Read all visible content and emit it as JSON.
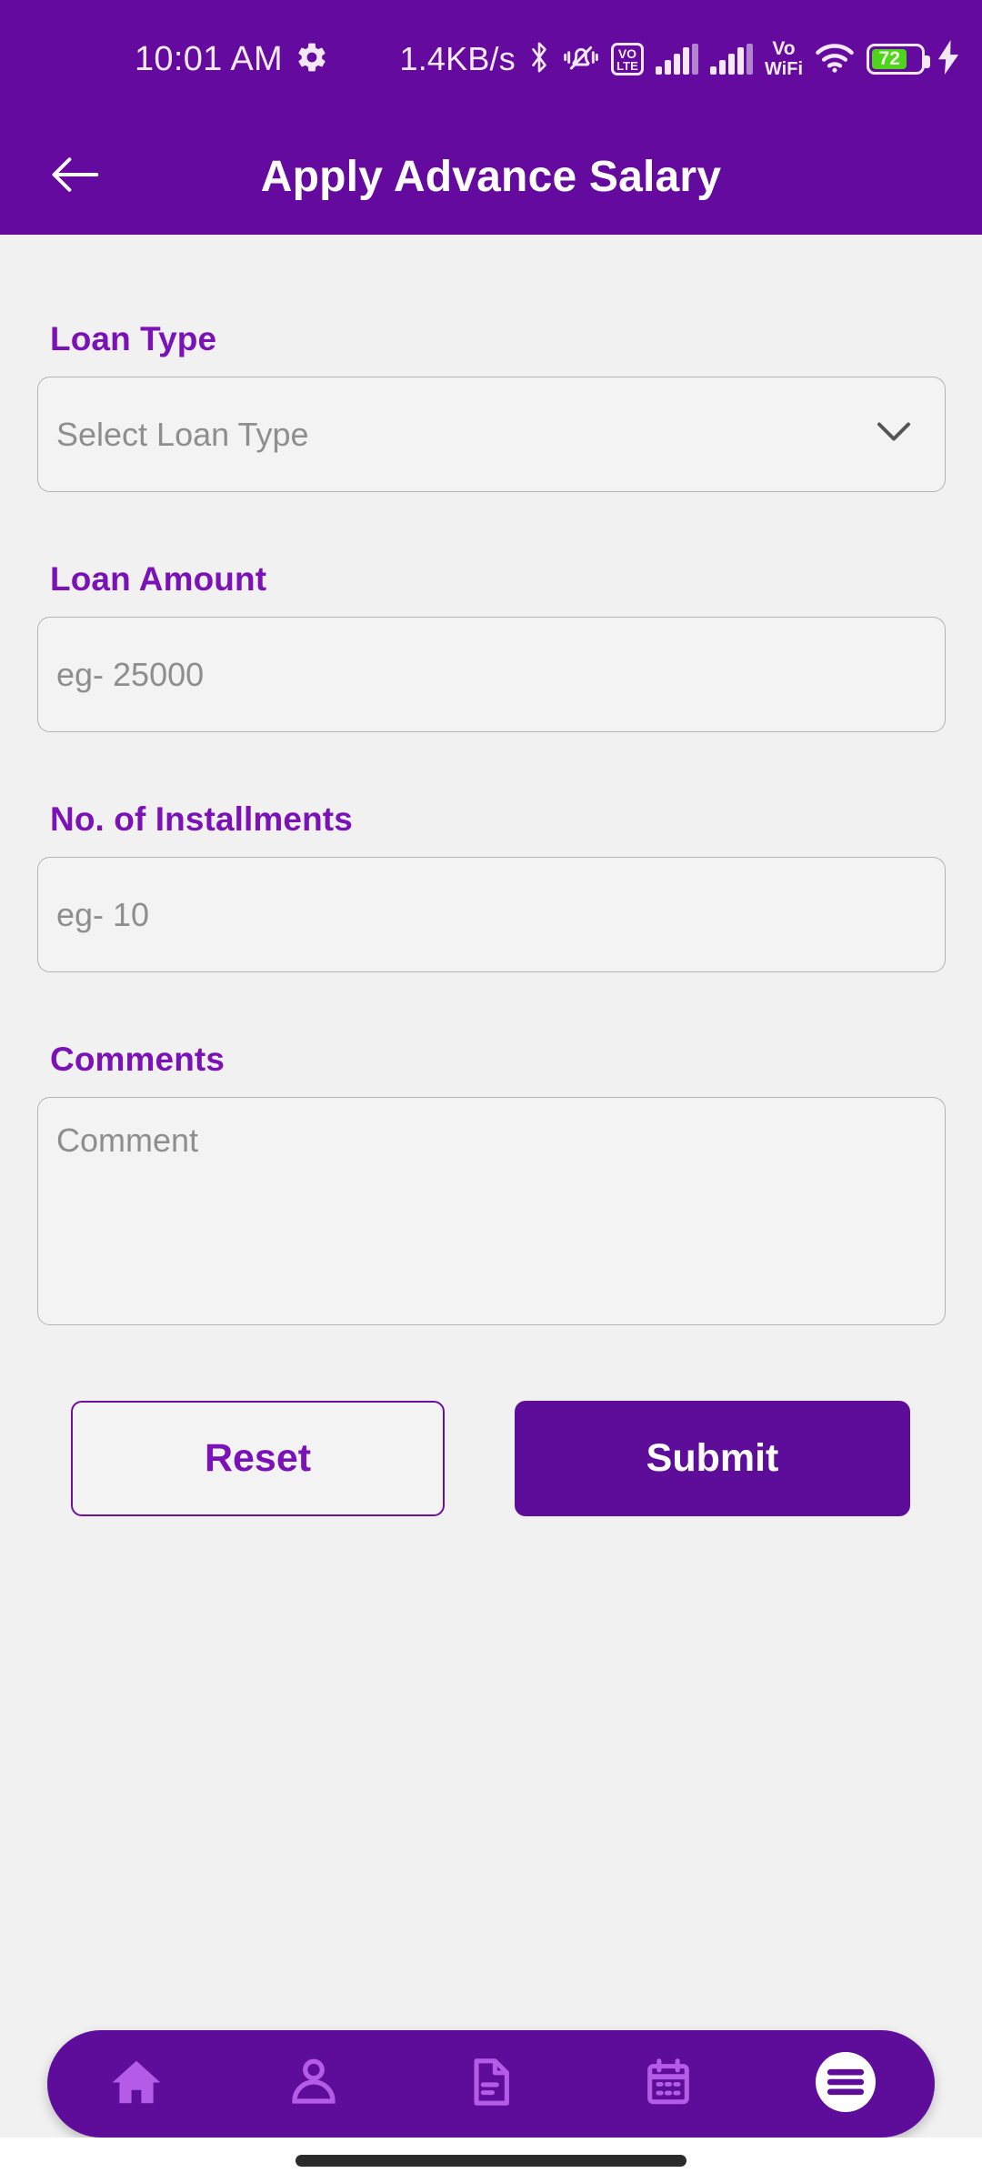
{
  "status_bar": {
    "time": "10:01 AM",
    "settings_icon": "gear-icon",
    "network_speed": "1.4KB/s",
    "bluetooth_icon": "bluetooth-icon",
    "silent_icon": "bell-muted-icon",
    "volte": {
      "line1": "VO",
      "line2": "LTE"
    },
    "signal_1_icon": "signal-bars-icon",
    "signal_2_icon": "signal-bars-icon",
    "vowifi": {
      "line1": "Vo",
      "line2": "WiFi"
    },
    "wifi_icon": "wifi-icon",
    "battery_level": "72",
    "charging_icon": "charging-bolt-icon",
    "background_color": "#650a9e",
    "foreground_color": "#f3e7f8",
    "battery_fill_color": "#4fd41c"
  },
  "app_bar": {
    "back_icon": "arrow-left-icon",
    "title": "Apply Advance Salary",
    "background_color": "#650a9e",
    "text_color": "#ffffff"
  },
  "form": {
    "background_color": "#f1f1f1",
    "label_color": "#7b12b8",
    "placeholder_color": "#8e8e8e",
    "fields": [
      {
        "label": "Loan Type",
        "type": "dropdown",
        "value": "",
        "placeholder": "Select Loan Type",
        "dropdown_icon": "chevron-down-icon"
      },
      {
        "label": "Loan Amount",
        "type": "text",
        "value": "",
        "placeholder": "eg- 25000"
      },
      {
        "label": "No. of Installments",
        "type": "text",
        "value": "",
        "placeholder": "eg- 10"
      },
      {
        "label": "Comments",
        "type": "textarea",
        "value": "",
        "placeholder": "Comment"
      }
    ]
  },
  "actions": {
    "reset_label": "Reset",
    "submit_label": "Submit",
    "reset_color": "#7b12b8",
    "submit_background": "#5e0d9b"
  },
  "bottom_nav": {
    "background_color": "#5e0d9b",
    "icon_color": "#b45ce8",
    "active_background": "#ffffff",
    "items": [
      {
        "icon": "home-icon",
        "name": "home"
      },
      {
        "icon": "person-icon",
        "name": "profile"
      },
      {
        "icon": "document-icon",
        "name": "documents"
      },
      {
        "icon": "calendar-icon",
        "name": "calendar"
      },
      {
        "icon": "menu-icon",
        "name": "menu",
        "active": true
      }
    ]
  }
}
